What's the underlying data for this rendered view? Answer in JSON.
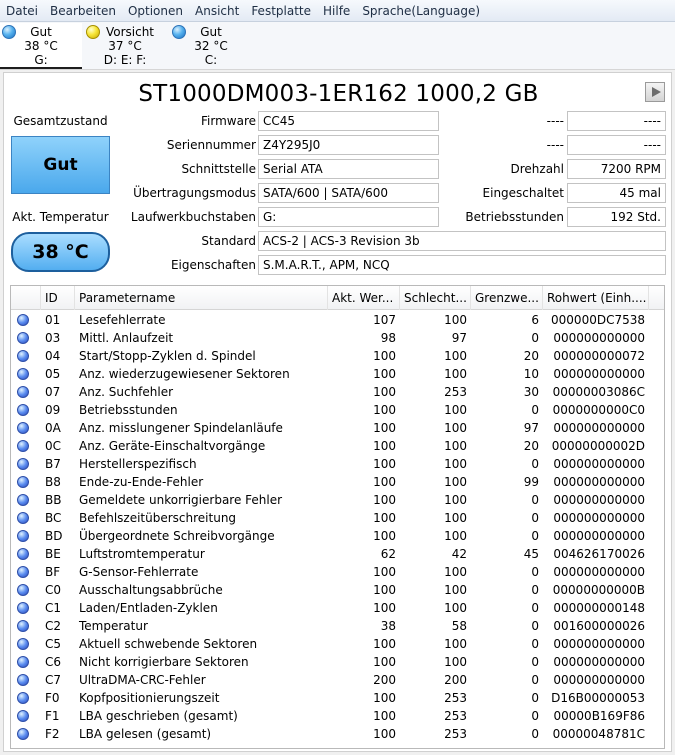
{
  "menu": [
    "Datei",
    "Bearbeiten",
    "Optionen",
    "Ansicht",
    "Festplatte",
    "Hilfe",
    "Sprache(Language)"
  ],
  "drives": [
    {
      "status": "Gut",
      "temp": "38 °C",
      "letters": "G:",
      "color": "blue",
      "selected": true
    },
    {
      "status": "Vorsicht",
      "temp": "37 °C",
      "letters": "D: E: F:",
      "color": "yellow",
      "selected": false
    },
    {
      "status": "Gut",
      "temp": "32 °C",
      "letters": "C:",
      "color": "blue",
      "selected": false
    }
  ],
  "title": "ST1000DM003-1ER162 1000,2 GB",
  "health": {
    "label": "Gesamtzustand",
    "value": "Gut"
  },
  "temperature": {
    "label": "Akt. Temperatur",
    "value": "38 °C"
  },
  "info": {
    "firmware_label": "Firmware",
    "firmware": "CC45",
    "serial_label": "Seriennummer",
    "serial": "Z4Y295J0",
    "interface_label": "Schnittstelle",
    "interface": "Serial ATA",
    "transfer_label": "Übertragungsmodus",
    "transfer": "SATA/600 | SATA/600",
    "letters_label": "Laufwerkbuchstaben",
    "letters": "G:",
    "standard_label": "Standard",
    "standard": "ACS-2 | ACS-3 Revision 3b",
    "features_label": "Eigenschaften",
    "features": "S.M.A.R.T., APM, NCQ",
    "blank1_label": "----",
    "blank1": "----",
    "blank2_label": "----",
    "blank2": "----",
    "rpm_label": "Drehzahl",
    "rpm": "7200 RPM",
    "power_count_label": "Eingeschaltet",
    "power_count": "45 mal",
    "power_hours_label": "Betriebsstunden",
    "power_hours": "192 Std."
  },
  "table": {
    "headers": [
      "ID",
      "Parametername",
      "Akt. Wer...",
      "Schlecht...",
      "Grenzwe...",
      "Rohwert (Einh...."
    ],
    "rows": [
      [
        "01",
        "Lesefehlerrate",
        "107",
        "100",
        "6",
        "000000DC7538"
      ],
      [
        "03",
        "Mittl. Anlaufzeit",
        "98",
        "97",
        "0",
        "000000000000"
      ],
      [
        "04",
        "Start/Stopp-Zyklen d. Spindel",
        "100",
        "100",
        "20",
        "000000000072"
      ],
      [
        "05",
        "Anz. wiederzugewiesener Sektoren",
        "100",
        "100",
        "10",
        "000000000000"
      ],
      [
        "07",
        "Anz. Suchfehler",
        "100",
        "253",
        "30",
        "00000003086C"
      ],
      [
        "09",
        "Betriebsstunden",
        "100",
        "100",
        "0",
        "0000000000C0"
      ],
      [
        "0A",
        "Anz. misslungener Spindelanläufe",
        "100",
        "100",
        "97",
        "000000000000"
      ],
      [
        "0C",
        "Anz. Geräte-Einschaltvorgänge",
        "100",
        "100",
        "20",
        "00000000002D"
      ],
      [
        "B7",
        "Herstellerspezifisch",
        "100",
        "100",
        "0",
        "000000000000"
      ],
      [
        "B8",
        "Ende-zu-Ende-Fehler",
        "100",
        "100",
        "99",
        "000000000000"
      ],
      [
        "BB",
        "Gemeldete unkorrigierbare Fehler",
        "100",
        "100",
        "0",
        "000000000000"
      ],
      [
        "BC",
        "Befehlszeitüberschreitung",
        "100",
        "100",
        "0",
        "000000000000"
      ],
      [
        "BD",
        "Übergeordnete Schreibvorgänge",
        "100",
        "100",
        "0",
        "000000000000"
      ],
      [
        "BE",
        "Luftstromtemperatur",
        "62",
        "42",
        "45",
        "004626170026"
      ],
      [
        "BF",
        "G-Sensor-Fehlerrate",
        "100",
        "100",
        "0",
        "000000000000"
      ],
      [
        "C0",
        "Ausschaltungsabbrüche",
        "100",
        "100",
        "0",
        "00000000000B"
      ],
      [
        "C1",
        "Laden/Entladen-Zyklen",
        "100",
        "100",
        "0",
        "000000000148"
      ],
      [
        "C2",
        "Temperatur",
        "38",
        "58",
        "0",
        "001600000026"
      ],
      [
        "C5",
        "Aktuell schwebende Sektoren",
        "100",
        "100",
        "0",
        "000000000000"
      ],
      [
        "C6",
        "Nicht korrigierbare Sektoren",
        "100",
        "100",
        "0",
        "000000000000"
      ],
      [
        "C7",
        "UltraDMA-CRC-Fehler",
        "200",
        "200",
        "0",
        "000000000000"
      ],
      [
        "F0",
        "Kopfpositionierungszeit",
        "100",
        "253",
        "0",
        "D16B00000053"
      ],
      [
        "F1",
        "LBA geschrieben (gesamt)",
        "100",
        "253",
        "0",
        "00000B169F86"
      ],
      [
        "F2",
        "LBA gelesen (gesamt)",
        "100",
        "253",
        "0",
        "00000048781C"
      ]
    ]
  }
}
